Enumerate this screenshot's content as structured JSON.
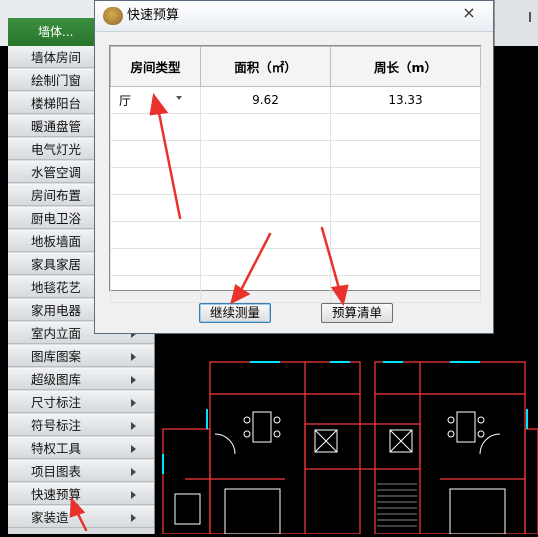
{
  "dialog": {
    "title": "快速预算",
    "close_symbol": "×",
    "columns": [
      "房间类型",
      "面积（㎡）",
      "周长（m）"
    ],
    "rows": [
      {
        "room_type": "厅",
        "area": "9.62",
        "perimeter": "13.33"
      }
    ],
    "buttons": {
      "continue": "继续测量",
      "list": "预算清单"
    }
  },
  "sidebar": {
    "header": "墙体...",
    "items": [
      {
        "label": "墙体房间",
        "submenu": false
      },
      {
        "label": "绘制门窗",
        "submenu": false
      },
      {
        "label": "楼梯阳台",
        "submenu": false
      },
      {
        "label": "暖通盘管",
        "submenu": false
      },
      {
        "label": "电气灯光",
        "submenu": false
      },
      {
        "label": "水管空调",
        "submenu": false
      },
      {
        "label": "房间布置",
        "submenu": false
      },
      {
        "label": "厨电卫浴",
        "submenu": false
      },
      {
        "label": "地板墙面",
        "submenu": false
      },
      {
        "label": "家具家居",
        "submenu": false
      },
      {
        "label": "地毯花艺",
        "submenu": false
      },
      {
        "label": "家用电器",
        "submenu": false
      },
      {
        "label": "室内立面",
        "submenu": true
      },
      {
        "label": "图库图案",
        "submenu": true
      },
      {
        "label": "超级图库",
        "submenu": true
      },
      {
        "label": "尺寸标注",
        "submenu": true
      },
      {
        "label": "符号标注",
        "submenu": true
      },
      {
        "label": "特权工具",
        "submenu": true
      },
      {
        "label": "项目图表",
        "submenu": true
      },
      {
        "label": "快速预算",
        "submenu": true
      },
      {
        "label": "家装造",
        "submenu": true
      }
    ]
  },
  "colors": {
    "annotation_arrow": "#e8322b",
    "cad_wall": "#ff3b3b",
    "cad_fixture": "#00e5ff",
    "cad_line": "#ffffff",
    "sidebar_header": "#2f8a33"
  }
}
